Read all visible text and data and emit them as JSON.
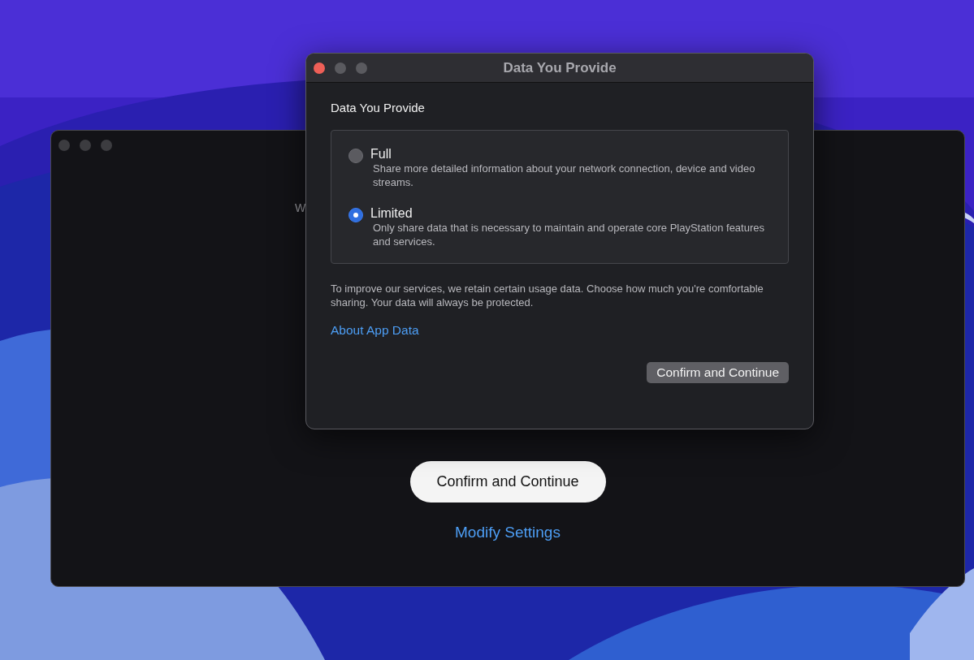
{
  "background_window": {
    "partial_text": "W",
    "primary_button": "Confirm and Continue",
    "link": "Modify Settings"
  },
  "dialog": {
    "title": "Data You Provide",
    "heading": "Data You Provide",
    "options": [
      {
        "label": "Full",
        "description": "Share more detailed information about your network connection, device and video streams.",
        "selected": false
      },
      {
        "label": "Limited",
        "description": "Only share data that is necessary to maintain and operate core PlayStation features and services.",
        "selected": true
      }
    ],
    "note": "To improve our services, we retain certain usage data. Choose how much you're comfortable sharing. Your data will always be protected.",
    "link": "About App Data",
    "button": "Confirm and Continue"
  }
}
